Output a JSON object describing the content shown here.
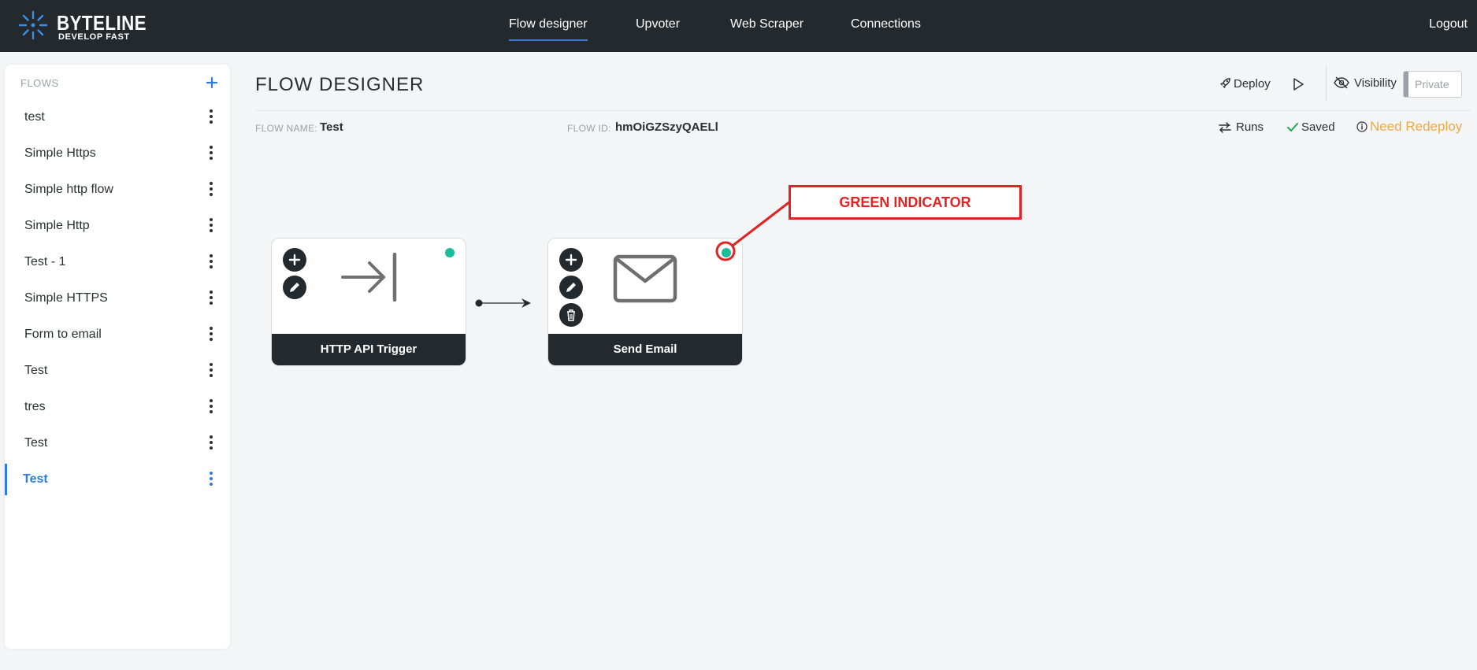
{
  "brand": {
    "name": "BYTELINE",
    "tagline": "DEVELOP FAST",
    "accent": "#2f7de1"
  },
  "nav": {
    "items": [
      {
        "label": "Flow designer",
        "active": true
      },
      {
        "label": "Upvoter"
      },
      {
        "label": "Web Scraper"
      },
      {
        "label": "Connections"
      }
    ],
    "logout": "Logout"
  },
  "sidebar": {
    "header": "FLOWS",
    "add_icon": "plus-icon",
    "items": [
      {
        "label": "test"
      },
      {
        "label": "Simple Https"
      },
      {
        "label": "Simple http flow"
      },
      {
        "label": "Simple Http"
      },
      {
        "label": "Test - 1"
      },
      {
        "label": "Simple HTTPS"
      },
      {
        "label": "Form to email"
      },
      {
        "label": "Test"
      },
      {
        "label": "tres"
      },
      {
        "label": "Test"
      },
      {
        "label": "Test",
        "active": true
      }
    ]
  },
  "header": {
    "title": "FLOW DESIGNER",
    "deploy": "Deploy",
    "visibility": "Visibility",
    "private": "Private",
    "flow_name_label": "FLOW NAME:",
    "flow_name": "Test",
    "flow_id_label": "FLOW ID:",
    "flow_id": "hmOiGZSzyQAELl",
    "runs": "Runs",
    "saved": "Saved",
    "redeploy": "Need Redeploy"
  },
  "canvas": {
    "nodes": [
      {
        "label": "HTTP API Trigger",
        "icon": "arrow-to-bar-icon",
        "status_color": "#1abc9c"
      },
      {
        "label": "Send Email",
        "icon": "envelope-icon",
        "status_color": "#1abc9c"
      }
    ],
    "annotation": "GREEN INDICATOR",
    "annotation_color": "#e02424"
  }
}
